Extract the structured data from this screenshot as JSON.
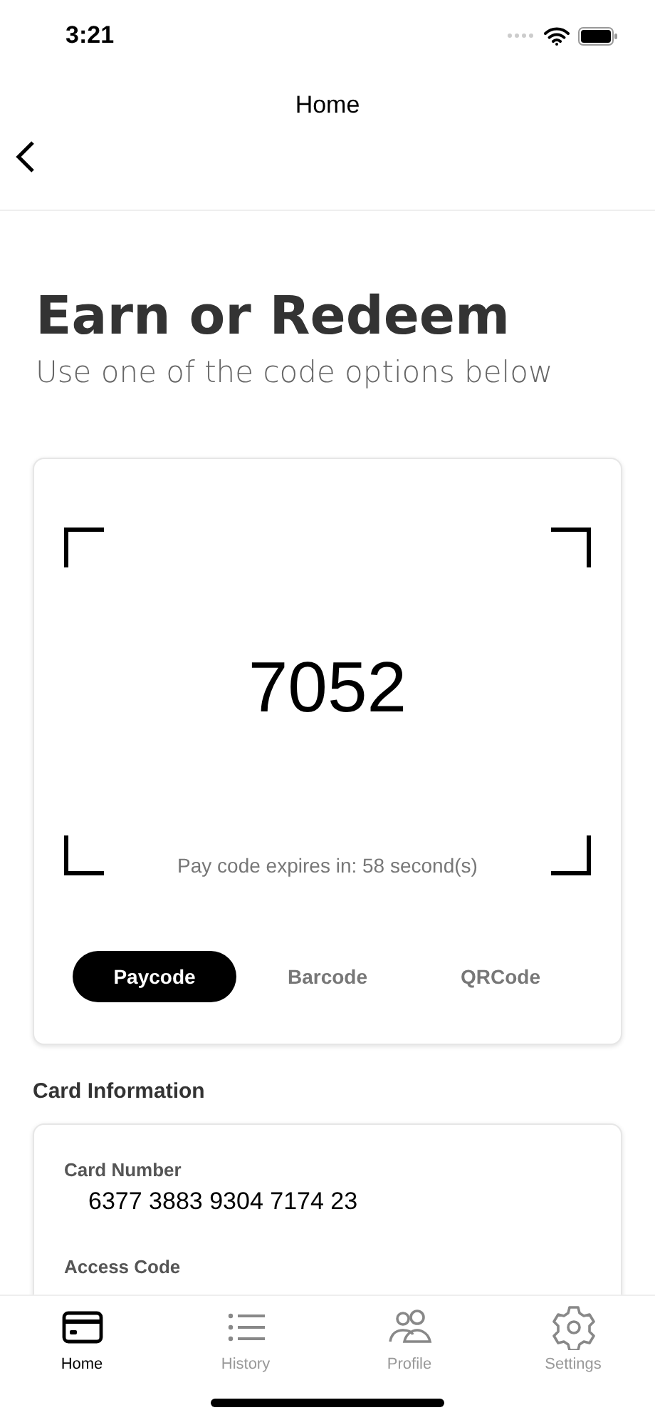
{
  "status_bar": {
    "time": "3:21"
  },
  "nav": {
    "title": "Home"
  },
  "heading": "Earn or Redeem",
  "subheading": "Use one of the code options below",
  "code_card": {
    "code": "7052",
    "expiry": "Pay code expires in: 58 second(s)",
    "options": [
      {
        "label": "Paycode",
        "selected": true
      },
      {
        "label": "Barcode",
        "selected": false
      },
      {
        "label": "QRCode",
        "selected": false
      }
    ]
  },
  "card_information": {
    "title": "Card Information",
    "fields": [
      {
        "label": "Card Number",
        "value": "6377 3883 9304 7174 23"
      },
      {
        "label": "Access Code"
      }
    ]
  },
  "tab_bar": [
    {
      "kind": "card",
      "label": "Home",
      "selected": true
    },
    {
      "kind": "list",
      "label": "History",
      "selected": false
    },
    {
      "kind": "people",
      "label": "Profile",
      "selected": false
    },
    {
      "kind": "gear",
      "label": "Settings",
      "selected": false
    }
  ]
}
